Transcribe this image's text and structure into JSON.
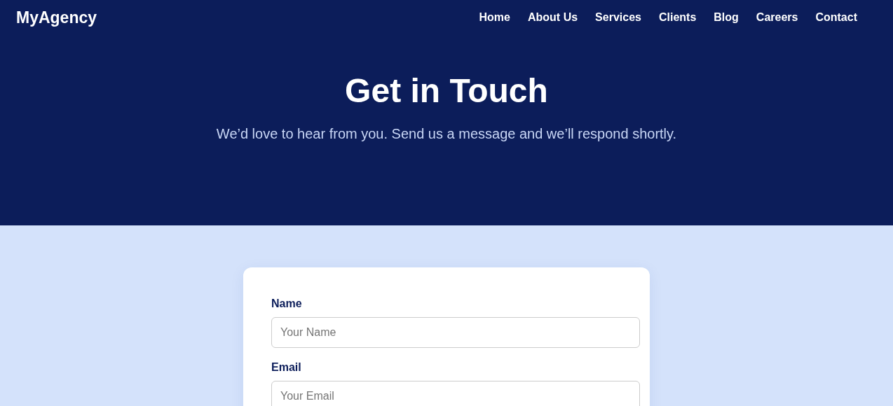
{
  "brand": "MyAgency",
  "nav": [
    "Home",
    "About Us",
    "Services",
    "Clients",
    "Blog",
    "Careers",
    "Contact"
  ],
  "hero": {
    "title": "Get in Touch",
    "subtitle": "We’d love to hear from you. Send us a message and we’ll respond shortly."
  },
  "form": {
    "fields": [
      {
        "label": "Name",
        "placeholder": "Your Name"
      },
      {
        "label": "Email",
        "placeholder": "Your Email"
      }
    ]
  }
}
